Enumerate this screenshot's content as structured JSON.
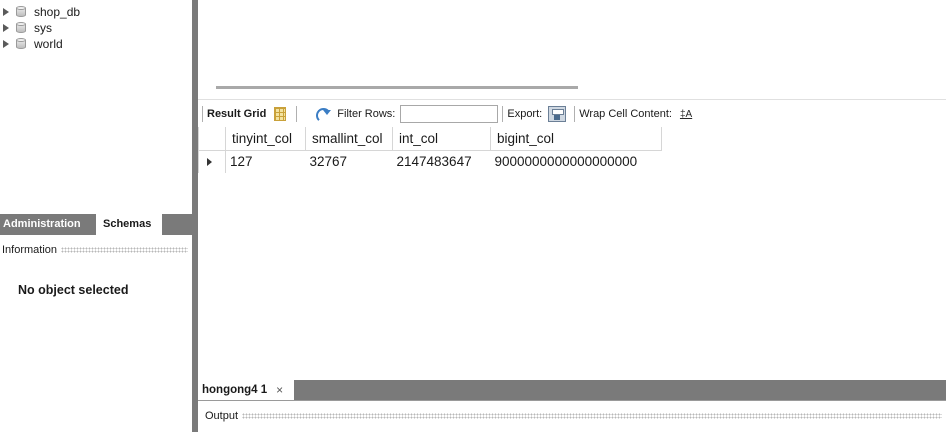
{
  "schemas_tree": {
    "items": [
      {
        "label": "shop_db"
      },
      {
        "label": "sys"
      },
      {
        "label": "world"
      }
    ]
  },
  "sidebar_tabs": {
    "administration": "Administration",
    "schemas": "Schemas"
  },
  "information_panel": {
    "header": "Information",
    "message": "No object selected"
  },
  "result_toolbar": {
    "result_grid": "Result Grid",
    "filter_rows": "Filter Rows:",
    "filter_value": "",
    "export": "Export:",
    "wrap_cell_content": "Wrap Cell Content:",
    "wrap_icon": "‡A"
  },
  "result_grid": {
    "columns": [
      "tinyint_col",
      "smallint_col",
      "int_col",
      "bigint_col"
    ],
    "rows": [
      [
        "127",
        "32767",
        "2147483647",
        "9000000000000000000"
      ]
    ]
  },
  "query_tab": {
    "label": "hongong4 1",
    "close": "×"
  },
  "output_panel": {
    "header": "Output"
  }
}
